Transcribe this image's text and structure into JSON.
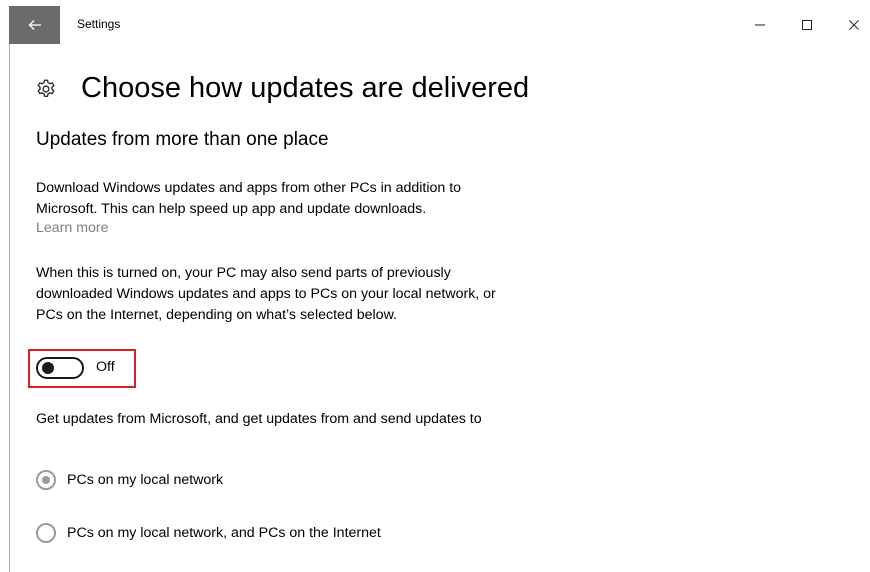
{
  "window": {
    "title": "Settings",
    "controls": {
      "minimize_icon": "minimize-icon",
      "maximize_icon": "maximize-icon",
      "close_icon": "close-icon"
    },
    "back_icon": "back-arrow-icon",
    "colors": {
      "back_button_bg": "#6b6b6b",
      "highlight_border": "#d62027"
    }
  },
  "page": {
    "icon": "gear-icon",
    "title": "Choose how updates are delivered",
    "section_title": "Updates from more than one place",
    "description": "Download Windows updates and apps from other PCs in addition to Microsoft. This can help speed up app and update downloads.",
    "learn_more": "Learn more",
    "detail": "When this is turned on, your PC may also send parts of previously downloaded Windows updates and apps to PCs on your local network, or PCs on the Internet, depending on what’s selected below.",
    "toggle": {
      "state": "Off",
      "on": false
    },
    "options_prompt": "Get updates from Microsoft, and get updates from and send updates to",
    "options": [
      {
        "label": "PCs on my local network",
        "selected": true
      },
      {
        "label": "PCs on my local network, and PCs on the Internet",
        "selected": false
      }
    ]
  }
}
